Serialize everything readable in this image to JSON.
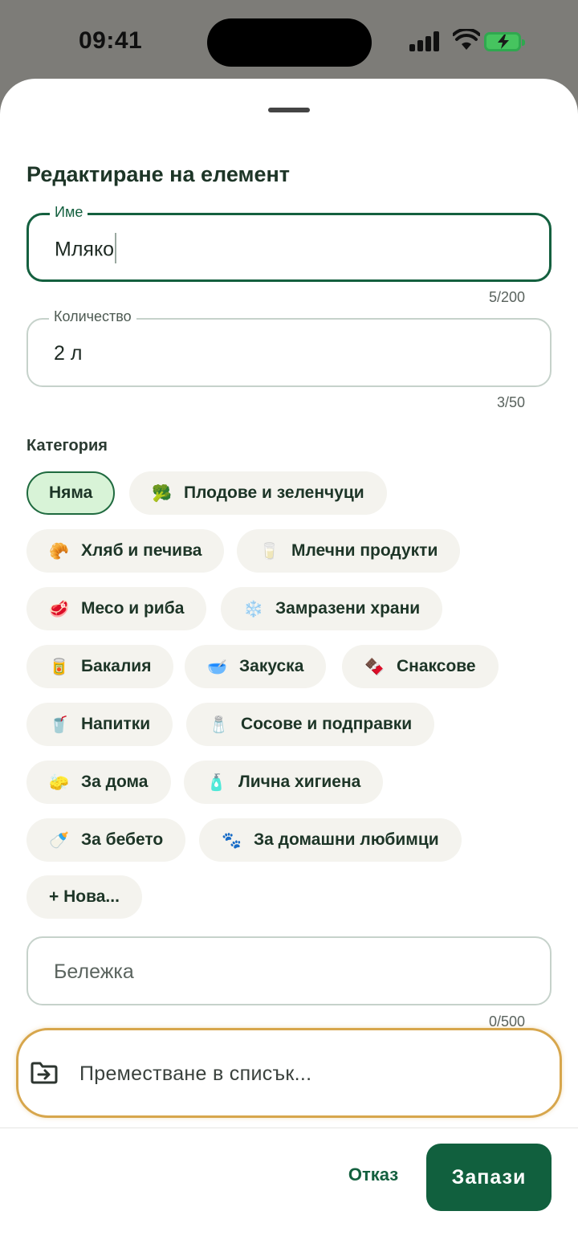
{
  "status_bar": {
    "time": "09:41"
  },
  "sheet": {
    "title": "Редактиране на елемент",
    "name_field": {
      "label": "Име",
      "value": "Мляко",
      "counter": "5/200"
    },
    "quantity_field": {
      "label": "Количество",
      "value": "2 л",
      "counter": "3/50"
    },
    "category": {
      "label": "Категория",
      "chips": [
        {
          "emoji": "",
          "label": "Няма",
          "selected": true
        },
        {
          "emoji": "🥦",
          "label": "Плодове и зеленчуци"
        },
        {
          "emoji": "🥐",
          "label": "Хляб и печива"
        },
        {
          "emoji": "🥛",
          "label": "Млечни продукти"
        },
        {
          "emoji": "🥩",
          "label": "Месо и риба"
        },
        {
          "emoji": "❄️",
          "label": "Замразени храни"
        },
        {
          "emoji": "🥫",
          "label": "Бакалия"
        },
        {
          "emoji": "🥣",
          "label": "Закуска"
        },
        {
          "emoji": "🍫",
          "label": "Снаксове"
        },
        {
          "emoji": "🥤",
          "label": "Напитки"
        },
        {
          "emoji": "🧂",
          "label": "Сосове и подправки"
        },
        {
          "emoji": "🧽",
          "label": "За дома"
        },
        {
          "emoji": "🧴",
          "label": "Лична хигиена"
        },
        {
          "emoji": "🍼",
          "label": "За бебето"
        },
        {
          "emoji": "🐾",
          "label": "За домашни любимци"
        },
        {
          "emoji": "",
          "label": "+ Нова..."
        }
      ]
    },
    "note_field": {
      "placeholder": "Бележка",
      "counter": "0/500"
    },
    "move_to_list": "Преместване в списък...",
    "actions": {
      "cancel": "Отказ",
      "save": "Запази"
    }
  }
}
